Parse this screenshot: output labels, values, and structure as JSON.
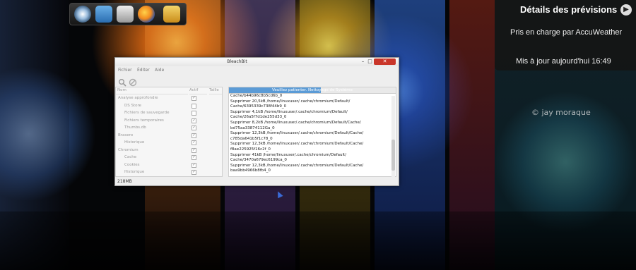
{
  "desktop": {
    "watermark": "© jay moraque"
  },
  "dock": {
    "items": [
      "app-launcher-icon",
      "file-manager-icon",
      "system-monitor-icon",
      "firefox-icon",
      "cleaner-icon"
    ]
  },
  "weather": {
    "title": "Détails des prévisions",
    "provider": "Pris en charge par AccuWeather",
    "updated": "Mis à jour  aujourd'hui 16:49"
  },
  "window": {
    "title": "BleachBit",
    "menu": [
      "Fichier",
      "Éditer",
      "Aide"
    ],
    "columns": {
      "name": "Nom",
      "active": "Actif",
      "size": "Taille"
    },
    "tree": [
      {
        "label": "Analyse approfondie",
        "level": 0,
        "checked": true
      },
      {
        "label": "DS Store",
        "level": 1,
        "checked": false
      },
      {
        "label": "Fichiers de sauvegarde",
        "level": 1,
        "checked": false
      },
      {
        "label": "Fichiers temporaires",
        "level": 1,
        "checked": true
      },
      {
        "label": "Thumbs.db",
        "level": 1,
        "checked": true
      },
      {
        "label": "Brasero",
        "level": 0,
        "checked": true
      },
      {
        "label": "Historique",
        "level": 1,
        "checked": true
      },
      {
        "label": "Chromium",
        "level": 0,
        "checked": true
      },
      {
        "label": "Cache",
        "level": 1,
        "checked": true
      },
      {
        "label": "Cookies",
        "level": 1,
        "checked": true
      },
      {
        "label": "Historique",
        "level": 1,
        "checked": true
      }
    ],
    "progress": {
      "text": "Veuillez patienter. Nettoyage de Système",
      "fraction": 0.55
    },
    "log": [
      "Cache/b44b96c8b5cd6b_0",
      "Supprimer 20,5kB /home/linuxuser/.cache/chromium/Default/",
      "Cache/6395339c738f44b9_0",
      "Supprimer 4,1kB /home/linuxuser/.cache/chromium/Default/",
      "Cache/26a5f7d1de255d33_0",
      "Supprimer 8,2kB /home/linuxuser/.cache/chromium/Default/Cache/",
      "bd75aa33874112Ga_0",
      "Supprimer 12,3kB /home/linuxuser/.cache/chromium/Default/Cache/",
      "c785da641b5f1c78_0",
      "Supprimer 12,3kB /home/linuxuser/.cache/chromium/Default/Cache/",
      "f8ae225925f16c2f_0",
      "Supprimer 41kB /home/linuxuser/.cache/chromium/Default/",
      "Cache/3470a679ec6199ca_0",
      "Supprimer 12,3kB /home/linuxuser/.cache/chromium/Default/Cache/",
      "baa9bb4966b8fb4_0"
    ],
    "status": "218MB"
  }
}
